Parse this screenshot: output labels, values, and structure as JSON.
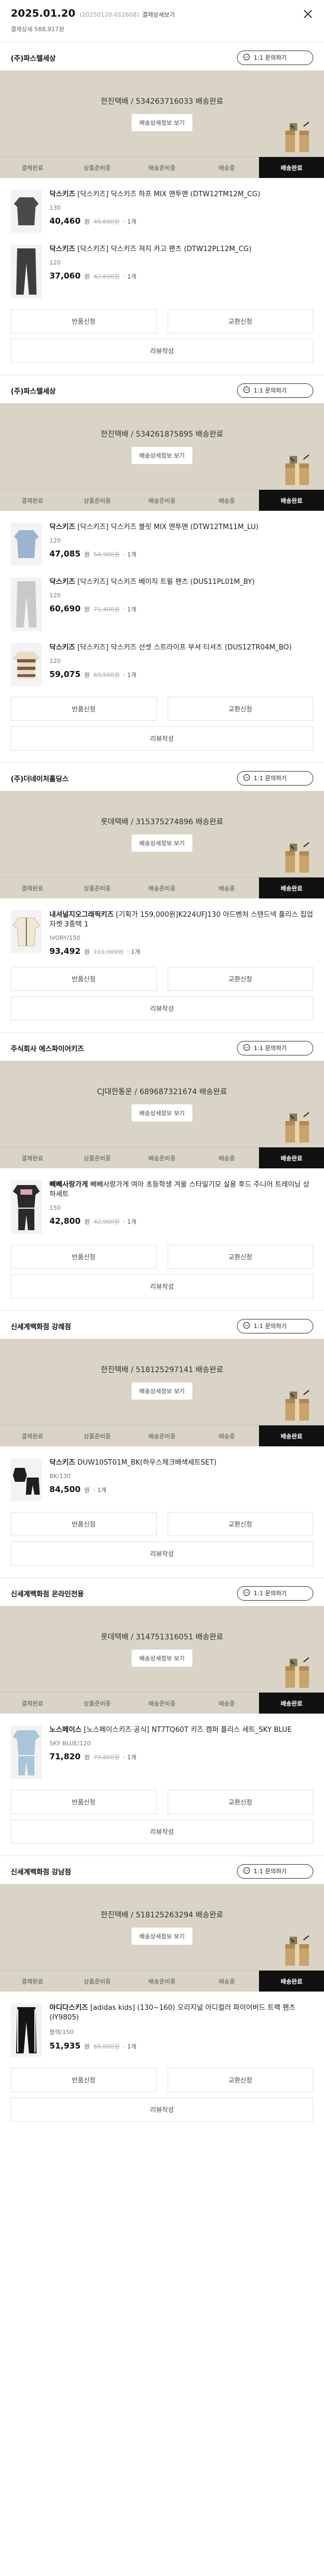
{
  "header": {
    "date": "2025.01.20",
    "order_no": "(20250120-012608)",
    "detail_label": "결제상세보기",
    "payment_total": "결제상세 588,917원"
  },
  "common": {
    "inquiry_label": "1:1 문의하기",
    "track_label": "배송상세정보 보기",
    "return_label": "반품신청",
    "exchange_label": "교환신청",
    "review_label": "리뷰작성",
    "won": "원",
    "qty": "1개",
    "steps": [
      "결제완료",
      "상품준비중",
      "배송준비중",
      "배송중",
      "배송완료"
    ]
  },
  "colors": {
    "delivery_bg": "#d9d4c5",
    "active_step_bg": "#111111"
  },
  "orders": [
    {
      "seller": "(주)파스텔세상",
      "delivery": "한진택배 / 534263716033 배송완료",
      "products": [
        {
          "name_brand": "닥스키즈",
          "name_rest": " [닥스키즈] 닥스키즈 하프 MIX 맨투맨 (DTW12TM12M_CG)",
          "option": "130",
          "price": "40,460",
          "original": "45,600원",
          "icon": "dark-sweatshirt-icon"
        },
        {
          "name_brand": "닥스키즈",
          "name_rest": " [닥스키즈] 닥스키즈 져지 카고 팬츠 (DTW12PL12M_CG)",
          "option": "120",
          "price": "37,060",
          "original": "42,600원",
          "icon": "cargo-pants-icon"
        }
      ]
    },
    {
      "seller": "(주)파스텔세상",
      "delivery": "한진택배 / 534261875895 배송완료",
      "products": [
        {
          "name_brand": "닥스키즈",
          "name_rest": " [닥스키즈] 닥스키즈 블릿 MIX 맨투맨 (DTW12TM11M_LU)",
          "option": "120",
          "price": "47,085",
          "original": "54,900원",
          "icon": "blue-sweatshirt-icon"
        },
        {
          "name_brand": "닥스키즈",
          "name_rest": " [닥스키즈] 닥스키즈 베이직 트윌 팬츠 (DUS11PL01M_BY)",
          "option": "120",
          "price": "60,690",
          "original": "71,400원",
          "icon": "gray-pants-icon"
        },
        {
          "name_brand": "닥스키즈",
          "name_rest": " [닥스키즈] 닥스키즈 선셋 스트라이프 부셔 티셔츠 (DUS12TR04M_BO)",
          "option": "120",
          "price": "59,075",
          "original": "69,500원",
          "icon": "striped-sweater-icon"
        }
      ]
    },
    {
      "seller": "(주)더네이처홀딩스",
      "delivery": "롯데택배 / 315375274896 배송완료",
      "products": [
        {
          "name_brand": "내셔널지오그래픽키즈",
          "name_rest": " [기획가 159,000원]K224UFJ130 아드벤처 스탠드넥 플리스 집업자켓 3종택 1",
          "option": "IVORY/150",
          "price": "93,492",
          "original": "111,300원",
          "icon": "fleece-jacket-icon"
        }
      ]
    },
    {
      "seller": "주식회사 에스파이어키즈",
      "delivery": "CJ대한통운 / 689687321674 배송완료",
      "products": [
        {
          "name_brand": "빼빼사랑가게",
          "name_rest": " 빼빼사랑가게 여아 초등학생 겨울 스타일기모 실용 후드 주니어 트레이닝 상하세트",
          "option": "150",
          "price": "42,800",
          "original": "42,900원",
          "icon": "kids-tracksuit-icon"
        }
      ]
    },
    {
      "seller": "신세계백화점 강례점",
      "delivery": "한진택배 / 518125297141 배송완료",
      "products": [
        {
          "name_brand": "닥스키즈",
          "name_rest": " DUW10ST01M_BK(하우스체크배색세트SET)",
          "option": "BK/130",
          "price": "84,500",
          "original": "",
          "icon": "black-set-icon"
        }
      ]
    },
    {
      "seller": "신세계백화점 온라인전용",
      "delivery": "롯데택배 / 314751316051 배송완료",
      "products": [
        {
          "name_brand": "노스페이스",
          "name_rest": " [노스페이스키즈 공식] NT7TQ60T 키즈 캠퍼 플리스 세트_SKY BLUE",
          "option": "SKY BLUE/120",
          "price": "71,820",
          "original": "79,800원",
          "icon": "skyblue-set-icon"
        }
      ]
    },
    {
      "seller": "신세계백화점 강남점",
      "delivery": "한진택배 / 518125263294 배송완료",
      "products": [
        {
          "name_brand": "아디다스키즈",
          "name_rest": " [adidas kids] (130~160) 오리지널 아디컬러 파이어버드 트랙 팬츠 (IY9805)",
          "option": "블랙/150",
          "price": "51,935",
          "original": "65,000원",
          "icon": "track-pants-icon"
        }
      ]
    }
  ]
}
